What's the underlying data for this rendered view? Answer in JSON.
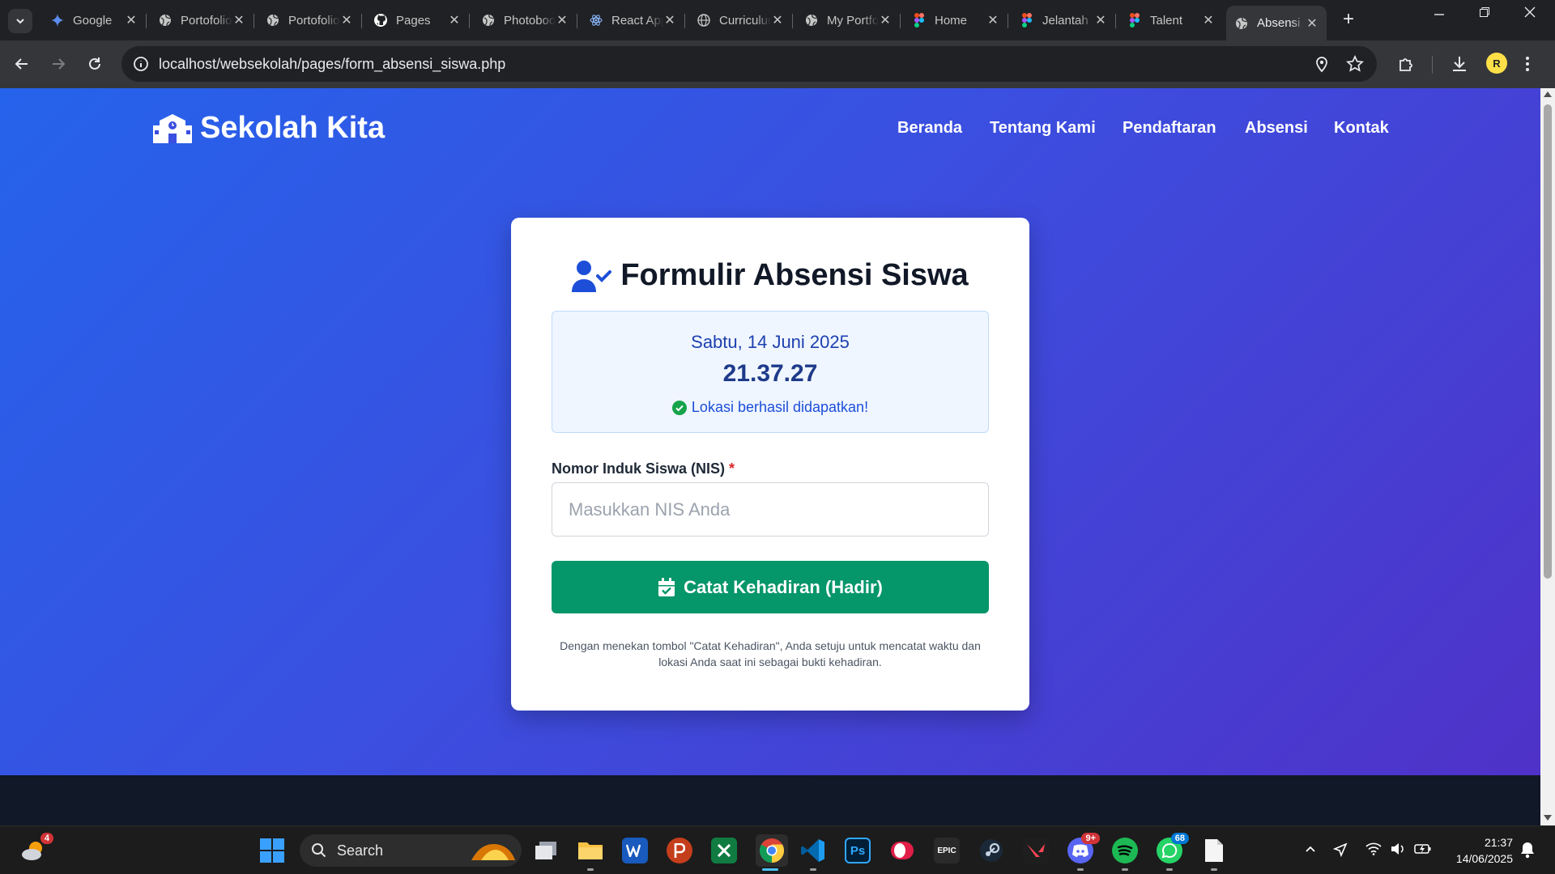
{
  "browser": {
    "tabs": [
      {
        "title": "Google",
        "icon": "gemini-icon"
      },
      {
        "title": "Portofolio",
        "icon": "globe-icon"
      },
      {
        "title": "Portofolio",
        "icon": "globe-icon"
      },
      {
        "title": "Pages",
        "icon": "github-icon"
      },
      {
        "title": "Photobooth",
        "icon": "globe-icon"
      },
      {
        "title": "React App",
        "icon": "react-icon"
      },
      {
        "title": "Curriculum",
        "icon": "globe-outline-icon"
      },
      {
        "title": "My Portfolio",
        "icon": "globe-icon"
      },
      {
        "title": "Home",
        "icon": "figma-icon"
      },
      {
        "title": "Jelantah",
        "icon": "figma-icon"
      },
      {
        "title": "Talent",
        "icon": "figma-icon"
      },
      {
        "title": "Absensi",
        "icon": "globe-icon",
        "active": true
      }
    ],
    "new_tab": "+",
    "url": "localhost/websekolah/pages/form_absensi_siswa.php",
    "profile_initial": "R"
  },
  "site": {
    "brand": "Sekolah Kita",
    "nav": [
      "Beranda",
      "Tentang Kami",
      "Pendaftaran",
      "Absensi",
      "Kontak"
    ]
  },
  "form": {
    "title": "Formulir Absensi Siswa",
    "date": "Sabtu, 14 Juni 2025",
    "time": "21.37.27",
    "location_status": "Lokasi berhasil didapatkan!",
    "nis_label": "Nomor Induk Siswa (NIS)",
    "required_mark": "*",
    "nis_placeholder": "Masukkan NIS Anda",
    "submit_label": "Catat Kehadiran (Hadir)",
    "disclaimer": "Dengan menekan tombol \"Catat Kehadiran\", Anda setuju untuk mencatat waktu dan lokasi Anda saat ini sebagai bukti kehadiran."
  },
  "colors": {
    "gradient_start": "#2563eb",
    "gradient_end": "#4f32c8",
    "accent_blue": "#1d4ed8",
    "submit_green": "#059669"
  },
  "taskbar": {
    "weather_badge": "4",
    "search_label": "Search",
    "discord_badge": "9+",
    "whatsapp_badge": "68",
    "time": "21:37",
    "date": "14/06/2025",
    "epic_label": "EPIC",
    "ps_label": "Ps"
  }
}
